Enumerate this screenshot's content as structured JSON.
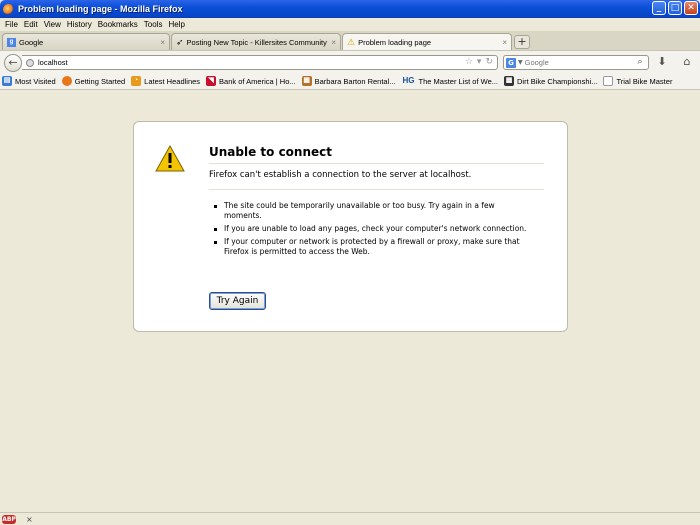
{
  "window": {
    "title": "Problem loading page - Mozilla Firefox",
    "minimize": "_",
    "maximize": "□",
    "close": "✕"
  },
  "menu": [
    "File",
    "Edit",
    "View",
    "History",
    "Bookmarks",
    "Tools",
    "Help"
  ],
  "tabs": [
    {
      "label": "Google",
      "icon": "google-favicon",
      "close": "×"
    },
    {
      "label": "Posting New Topic - Killersites Community",
      "icon": "killersites-favicon",
      "close": "×"
    },
    {
      "label": "Problem loading page",
      "icon": "warning-icon",
      "close": "×",
      "active": true
    }
  ],
  "new_tab": "+",
  "nav": {
    "url": "localhost",
    "search_placeholder": "Google",
    "search_engine": "G"
  },
  "bookmarks": [
    {
      "label": "Most Visited",
      "icon": "most-visited-icon",
      "color": "#3A7BD5"
    },
    {
      "label": "Getting Started",
      "icon": "firefox-icon",
      "color": "#E8761A"
    },
    {
      "label": "Latest Headlines",
      "icon": "rss-icon",
      "color": "#E89A1A"
    },
    {
      "label": "Bank of America | Ho...",
      "icon": "bofa-icon",
      "color": "#C8102E"
    },
    {
      "label": "Barbara Barton Rental...",
      "icon": "barbara-icon",
      "color": "#B5722A"
    },
    {
      "label": "The Master List of We...",
      "icon": "hg-icon",
      "color": "#1B4F9C"
    },
    {
      "label": "Dirt Bike Championshi...",
      "icon": "dirtbike-icon",
      "color": "#333333"
    },
    {
      "label": "Trial Bike Master",
      "icon": "page-icon",
      "color": "#FFFFFF"
    }
  ],
  "error": {
    "title": "Unable to connect",
    "description": "Firefox can't establish a connection to the server at localhost.",
    "items": [
      "The site could be temporarily unavailable or too busy. Try again in a few moments.",
      "If you are unable to load any pages, check your computer's network connection.",
      "If your computer or network is protected by a firewall or proxy, make sure that Firefox is permitted to access the Web."
    ],
    "button": "Try Again"
  },
  "status": {
    "addon_badge": "ABP",
    "close": "×"
  }
}
